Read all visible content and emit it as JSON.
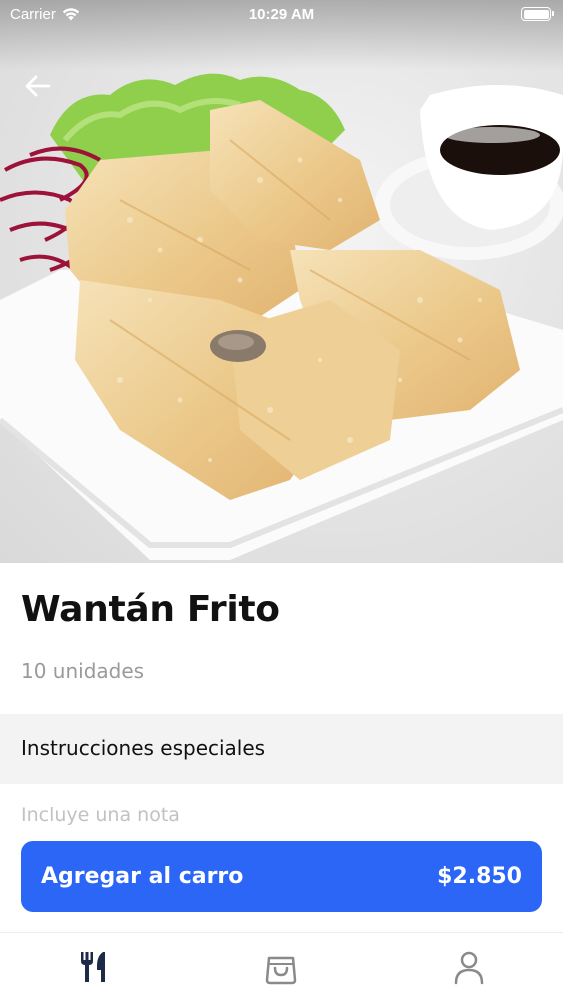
{
  "status_bar": {
    "carrier": "Carrier",
    "time": "10:29 AM",
    "battery_level": 1.0
  },
  "product": {
    "name": "Wantán Frito",
    "description": "10 unidades",
    "image_icon": "fried-wonton-photo"
  },
  "special_instructions": {
    "heading": "Instrucciones especiales",
    "note_placeholder": "Incluye una nota",
    "note_value": ""
  },
  "cart_button": {
    "label": "Agregar al carro",
    "price": "$2.850",
    "color": "#2b66f6"
  },
  "bottom_nav": {
    "items": [
      {
        "icon": "fork-knife-icon",
        "active": true
      },
      {
        "icon": "shopping-bag-icon",
        "active": false
      },
      {
        "icon": "user-icon",
        "active": false
      }
    ],
    "active_color": "#1f2b46",
    "inactive_color": "#8a8a8a"
  }
}
